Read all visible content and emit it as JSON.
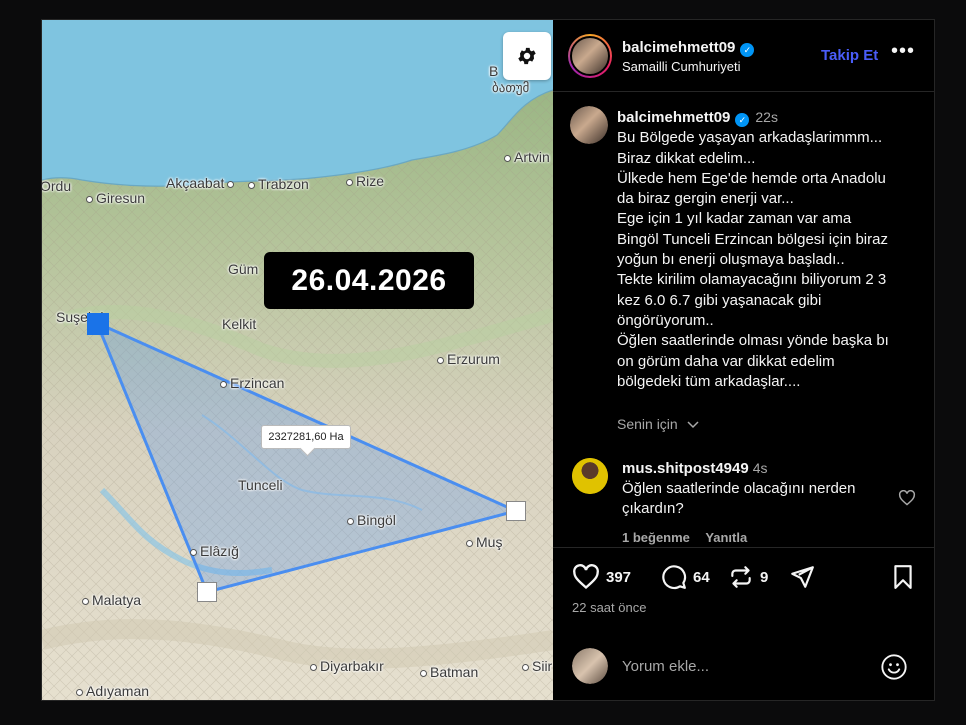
{
  "map": {
    "date_badge": "26.04.2026",
    "area_label": "2327281,60 Ha",
    "cities": [
      "Ordu",
      "Giresun",
      "Akçaabat",
      "Trabzon",
      "Rize",
      "Artvin",
      "Gümüşhane",
      "Şuşehri",
      "Kelkit",
      "Erzurum",
      "Erzincan",
      "Tunceli",
      "Bingöl",
      "Elazığ",
      "Muş",
      "Malatya",
      "Diyarbakır",
      "Batman",
      "Siirt",
      "Adıyaman",
      "Batumi"
    ],
    "city_labels": {
      "ordu": "Ordu",
      "giresun": "Giresun",
      "akcaabat": "Akçaabat",
      "trabzon": "Trabzon",
      "rize": "Rize",
      "artvin": "Artvin",
      "gum": "Güm",
      "susehri": "Suşehri",
      "kelkit": "Kelkit",
      "erzurum": "Erzurum",
      "erzincan": "Erzincan",
      "tunceli": "Tunceli",
      "bingol": "Bingöl",
      "elazig": "Elâzığ",
      "mus": "Muş",
      "malatya": "Malatya",
      "diyarbakir": "Diyarbakır",
      "batman": "Batman",
      "siirt": "Siir",
      "adiyaman": "Adıyaman",
      "batumi_1": "B",
      "batumi_2": "ბათუმ"
    }
  },
  "post": {
    "username": "balcimehmett09",
    "location": "Samailli Cumhuriyeti",
    "follow_label": "Takip Et",
    "more_label": "•••",
    "caption_time": "22s",
    "caption_lines": [
      "Bu Bölgede yaşayan arkadaşlarimmm...",
      "Biraz dikkat edelim...",
      "Ülkede hem Ege'de hemde orta Anadolu",
      "da biraz gergin enerji var...",
      "Ege için 1 yıl kadar zaman var ama",
      "Bingöl Tunceli Erzincan bölgesi için biraz",
      "yoğun bı enerji oluşmaya başladı..",
      "Tekte kirilim olamayacağını biliyorum 2 3",
      "kez 6.0 6.7 gibi yaşanacak gibi",
      "öngörüyorum..",
      "Öğlen saatlerinde olması yönde başka bı",
      "on görüm daha var dikkat edelim",
      "bölgedeki tüm arkadaşlar...."
    ],
    "for_you_label": "Senin için",
    "comment": {
      "username": "mus.shitpost4949",
      "time": "4s",
      "text_line1": "Öğlen saatlerinde olacağını nerden",
      "text_line2": "çıkardın?",
      "likes_label": "1 beğenme",
      "reply_label": "Yanıtla"
    },
    "likes_count": "397",
    "comments_count": "64",
    "reposts_count": "9",
    "time_ago": "22 saat önce",
    "add_comment_placeholder": "Yorum ekle..."
  },
  "colors": {
    "accent": "#0095f6",
    "follow": "#4a5df9",
    "polygon": "#4a8ef0",
    "sea": "#7fc4e0"
  },
  "icons": [
    "gear-icon",
    "verified-icon",
    "more-icon",
    "chevron-down-icon",
    "heart-icon",
    "comment-icon",
    "repost-icon",
    "share-icon",
    "bookmark-icon",
    "emoji-icon"
  ]
}
